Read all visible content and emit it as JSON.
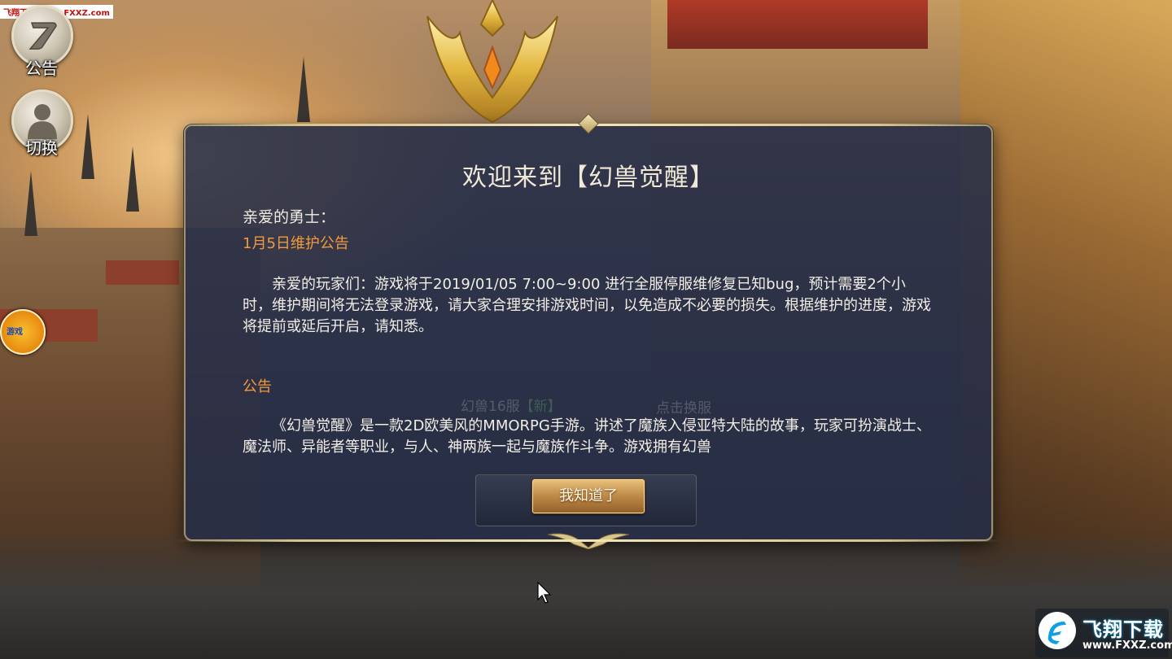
{
  "watermark_top": "飞翔下载 www.FXXZ.com",
  "side_buttons": {
    "notice_label": "公告",
    "switch_label": "切换"
  },
  "background_text": {
    "server_name": "幻兽16服",
    "server_tag": "【新】",
    "switch_hint": "点击换服"
  },
  "dialog": {
    "title": "欢迎来到【幻兽觉醒】",
    "greeting": "亲爱的勇士：",
    "sections": [
      {
        "heading": "1月5日维护公告",
        "body": "亲爱的玩家们：游戏将于2019/01/05 7:00~9:00 进行全服停服维修复已知bug，预计需要2个小时，维护期间将无法登录游戏，请大家合理安排游戏时间，以免造成不必要的损失。根据维护的进度，游戏将提前或延后开启，请知悉。"
      },
      {
        "heading": "公告",
        "body": "《幻兽觉醒》是一款2D欧美风的MMORPG手游。讲述了魔族入侵亚特大陆的故事，玩家可扮演战士、魔法师、异能者等职业，与人、神两族一起与魔族作斗争。游戏拥有幻兽"
      }
    ],
    "confirm_label": "我知道了"
  },
  "watermark_bottom": {
    "brand": "飞翔下载",
    "url": "www.FXXZ.com"
  },
  "colors": {
    "panel": "#262e48",
    "section_heading": "#f29a3c",
    "button_gold": "#c28d4a",
    "frame_gold": "#d8c58c"
  }
}
